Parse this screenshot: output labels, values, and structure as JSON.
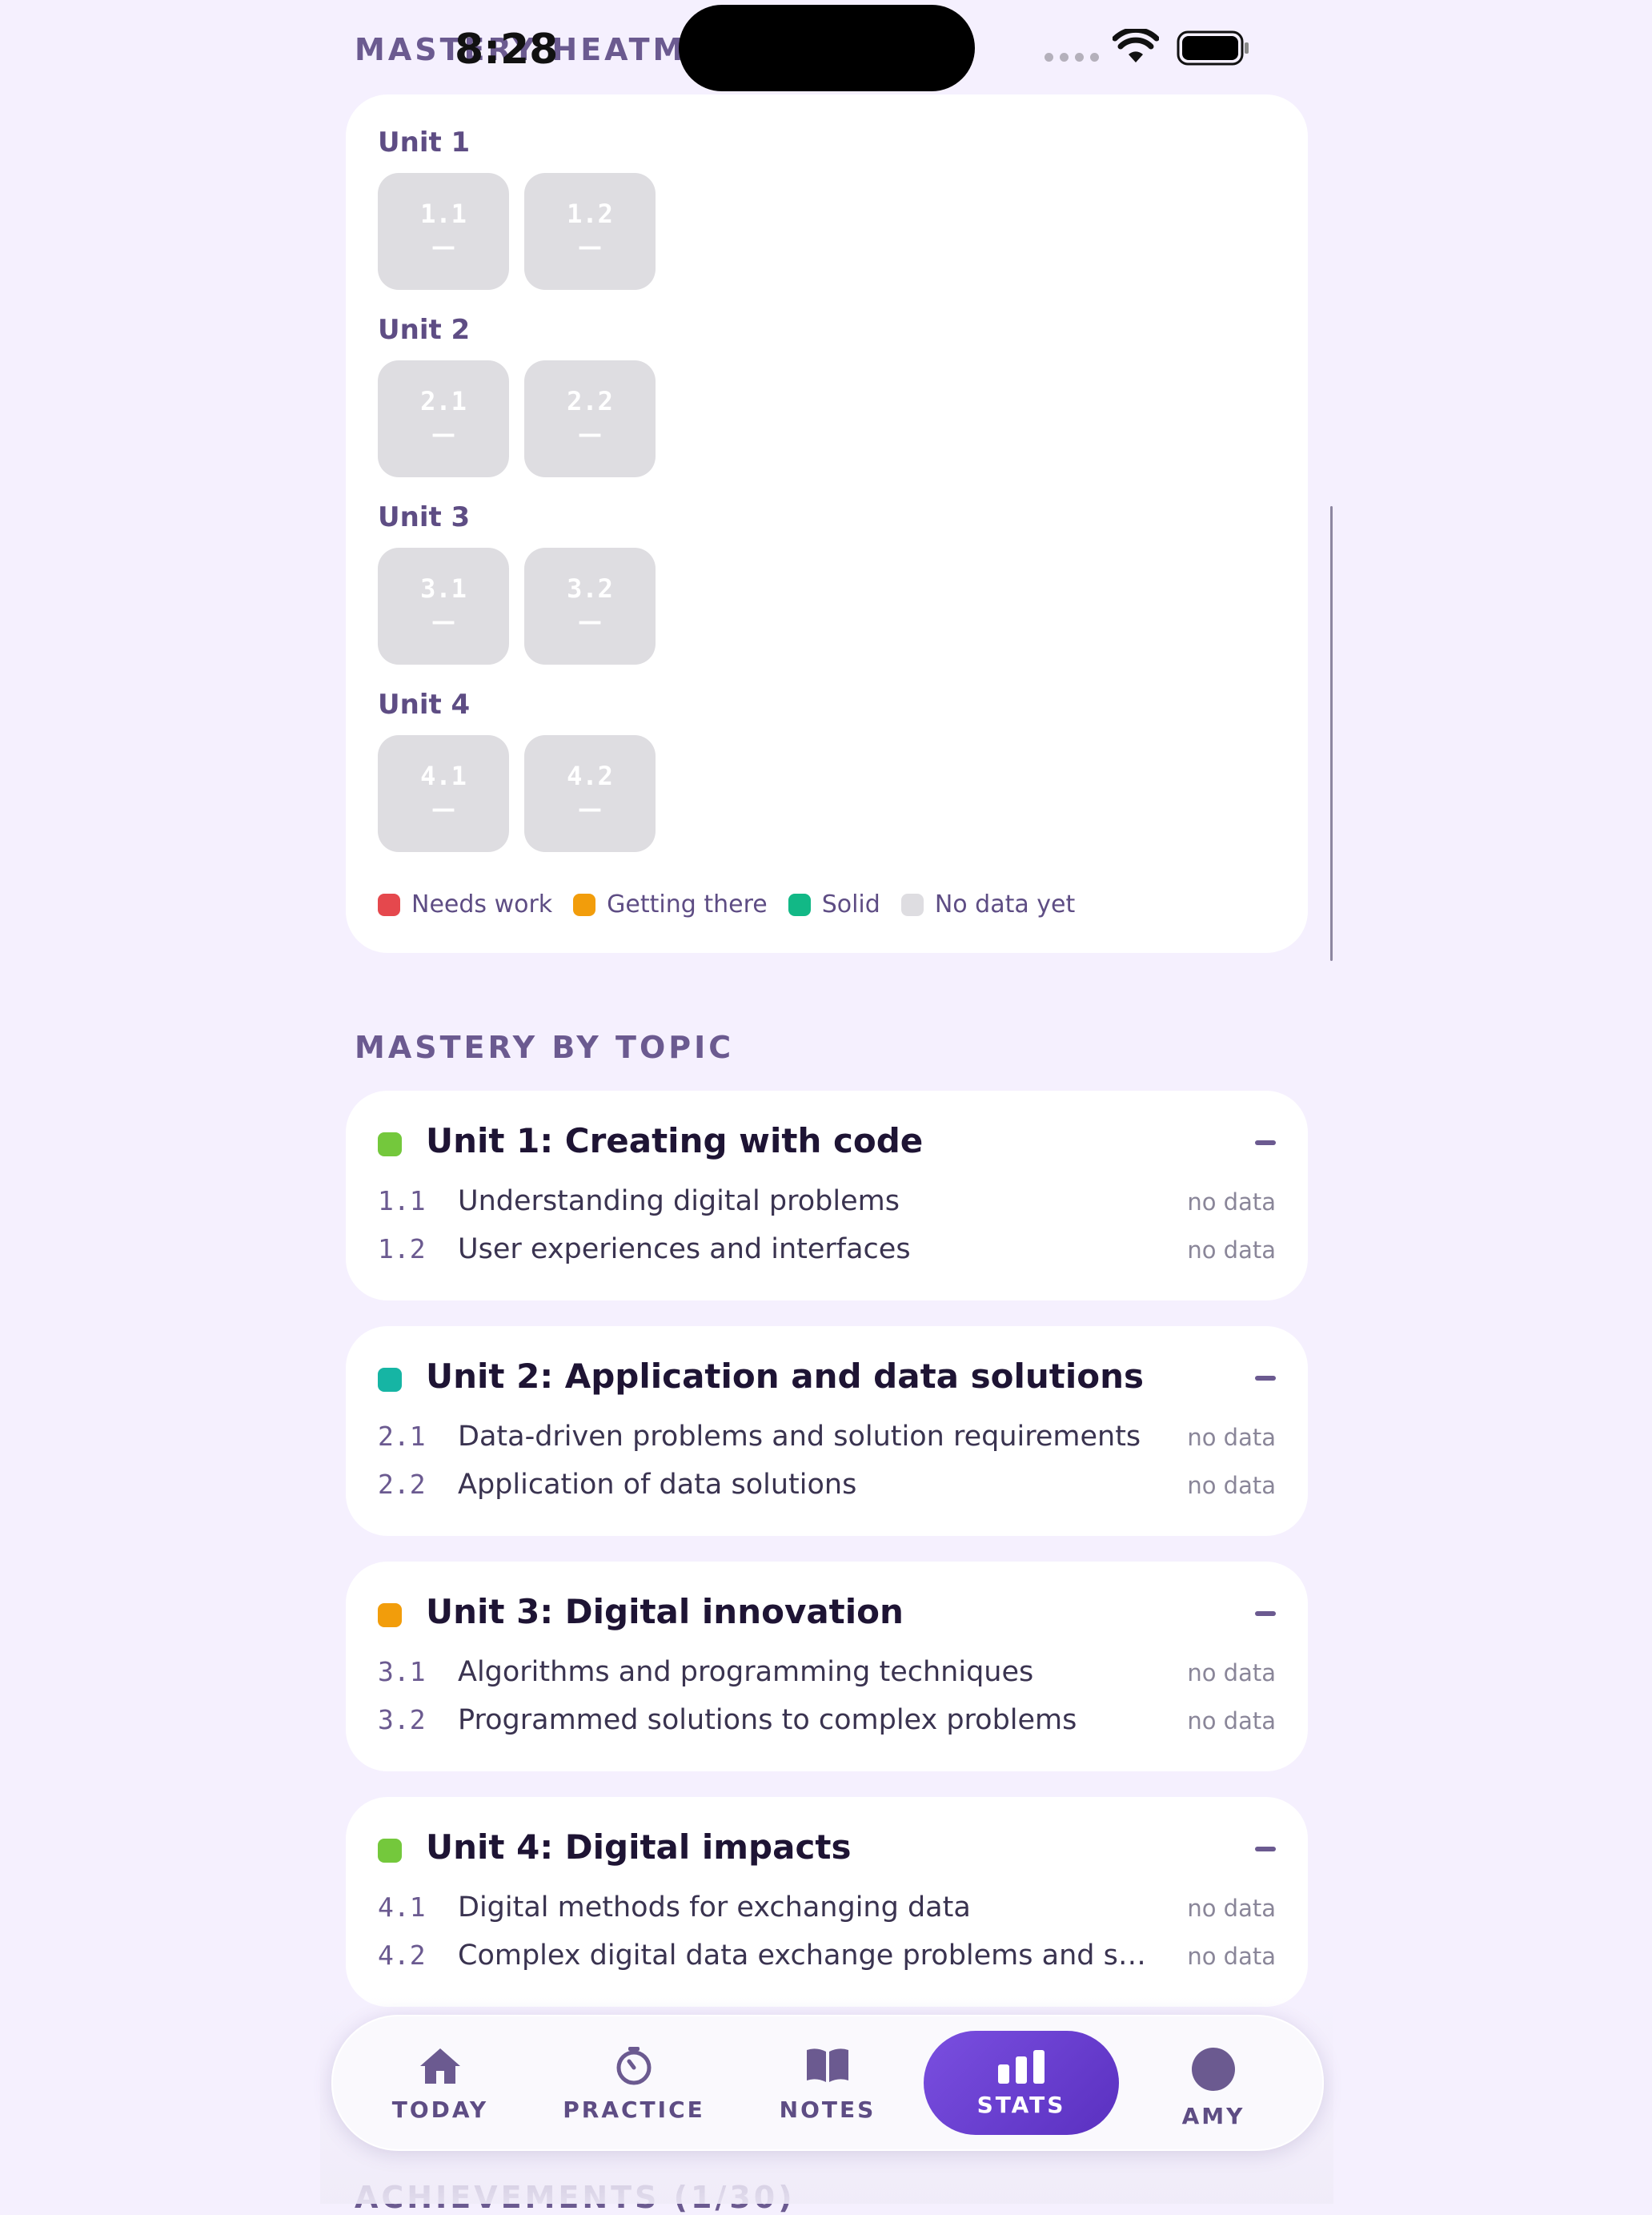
{
  "status_bar": {
    "time": "8:28"
  },
  "heatmap": {
    "section_title": "MASTERY HEATMAP",
    "units": [
      {
        "label": "Unit 1",
        "tiles": [
          {
            "code": "1.1",
            "value": "—"
          },
          {
            "code": "1.2",
            "value": "—"
          }
        ]
      },
      {
        "label": "Unit 2",
        "tiles": [
          {
            "code": "2.1",
            "value": "—"
          },
          {
            "code": "2.2",
            "value": "—"
          }
        ]
      },
      {
        "label": "Unit 3",
        "tiles": [
          {
            "code": "3.1",
            "value": "—"
          },
          {
            "code": "3.2",
            "value": "—"
          }
        ]
      },
      {
        "label": "Unit 4",
        "tiles": [
          {
            "code": "4.1",
            "value": "—"
          },
          {
            "code": "4.2",
            "value": "—"
          }
        ]
      }
    ],
    "legend": [
      {
        "label": "Needs work",
        "color": "#e5484d"
      },
      {
        "label": "Getting there",
        "color": "#f29d0b"
      },
      {
        "label": "Solid",
        "color": "#12b886"
      },
      {
        "label": "No data yet",
        "color": "#dedde1"
      }
    ]
  },
  "topics": {
    "section_title": "MASTERY BY TOPIC",
    "units": [
      {
        "title": "Unit 1: Creating with code",
        "color": "#74c83c",
        "rows": [
          {
            "num": "1.1",
            "name": "Understanding digital problems",
            "status": "no data"
          },
          {
            "num": "1.2",
            "name": "User experiences and interfaces",
            "status": "no data"
          }
        ]
      },
      {
        "title": "Unit 2: Application and data solutions",
        "color": "#16b5a4",
        "rows": [
          {
            "num": "2.1",
            "name": "Data-driven problems and solution requirements",
            "status": "no data"
          },
          {
            "num": "2.2",
            "name": "Application of data solutions",
            "status": "no data"
          }
        ]
      },
      {
        "title": "Unit 3: Digital innovation",
        "color": "#f29d0b",
        "rows": [
          {
            "num": "3.1",
            "name": "Algorithms and programming techniques",
            "status": "no data"
          },
          {
            "num": "3.2",
            "name": "Programmed solutions to complex problems",
            "status": "no data"
          }
        ]
      },
      {
        "title": "Unit 4: Digital impacts",
        "color": "#74c83c",
        "rows": [
          {
            "num": "4.1",
            "name": "Digital methods for exchanging data",
            "status": "no data"
          },
          {
            "num": "4.2",
            "name": "Complex digital data exchange problems and sol...",
            "status": "no data"
          }
        ]
      }
    ]
  },
  "nav": {
    "items": [
      {
        "label": "TODAY",
        "icon": "home-icon"
      },
      {
        "label": "PRACTICE",
        "icon": "timer-icon"
      },
      {
        "label": "NOTES",
        "icon": "book-icon"
      },
      {
        "label": "STATS",
        "icon": "bar-chart-icon",
        "active": true
      },
      {
        "label": "AMY",
        "icon": "avatar-icon"
      }
    ]
  },
  "achievements": {
    "section_title": "ACHIEVEMENTS (1/30)"
  }
}
